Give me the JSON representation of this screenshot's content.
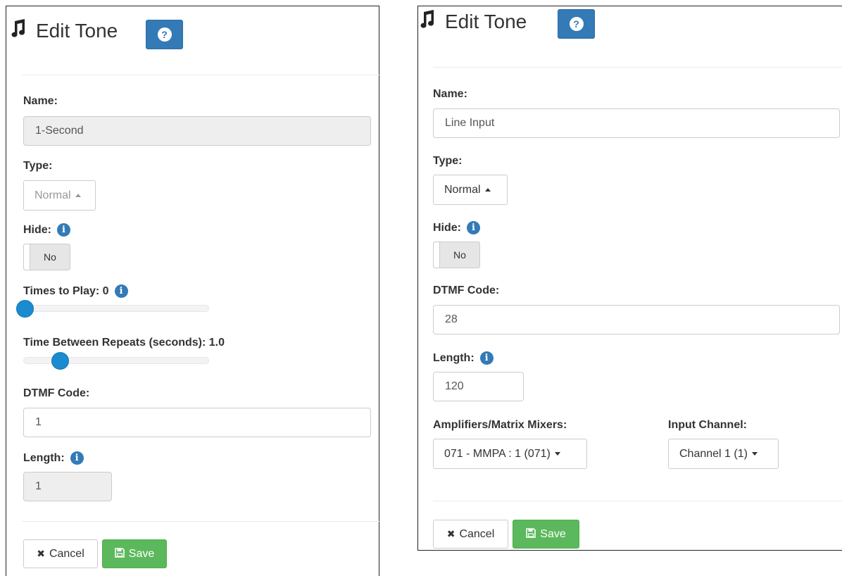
{
  "left": {
    "title": "Edit Tone",
    "help_glyph": "?",
    "name_label": "Name:",
    "name_value": "1-Second",
    "type_label": "Type:",
    "type_value": "Normal",
    "hide_label": "Hide:",
    "hide_value": "No",
    "times_label": "Times to Play: 0",
    "times_slider_fraction": 0.0,
    "repeats_label": "Time Between Repeats (seconds): 1.0",
    "repeats_slider_fraction": 0.19,
    "dtmf_label": "DTMF Code:",
    "dtmf_value": "1",
    "length_label": "Length:",
    "length_value": "1",
    "cancel_label": "Cancel",
    "save_label": "Save"
  },
  "right": {
    "title": "Edit Tone",
    "help_glyph": "?",
    "name_label": "Name:",
    "name_value": "Line Input",
    "type_label": "Type:",
    "type_value": "Normal",
    "hide_label": "Hide:",
    "hide_value": "No",
    "dtmf_label": "DTMF Code:",
    "dtmf_value": "28",
    "length_label": "Length:",
    "length_value": "120",
    "amp_label": "Amplifiers/Matrix Mixers:",
    "amp_value": "071 - MMPA : 1 (071)",
    "channel_label": "Input Channel:",
    "channel_value": "Channel 1 (1)",
    "cancel_label": "Cancel",
    "save_label": "Save"
  },
  "icons": {
    "title": "music-note-icon",
    "help": "question-circle-icon",
    "info": "info-circle-icon",
    "cancel": "times-icon",
    "save": "floppy-disk-icon"
  },
  "colors": {
    "primary": "#337ab7",
    "success": "#5cb85c",
    "slider": "#1a8bd1"
  }
}
